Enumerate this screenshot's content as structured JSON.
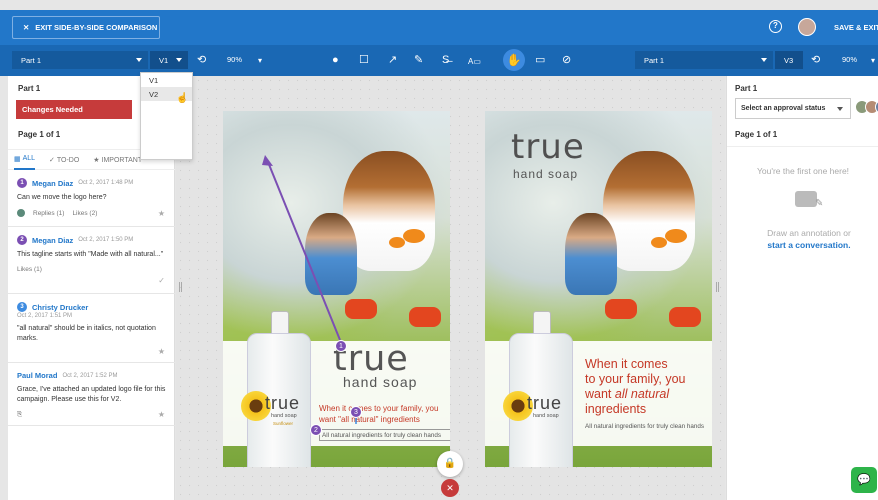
{
  "header": {
    "exit_label": "EXIT SIDE-BY-SIDE COMPARISON",
    "help_icon": "question-circle-icon",
    "save_exit_label": "SAVE & EXIT"
  },
  "toolbar": {
    "left_part": "Part 1",
    "left_version": "V1",
    "left_zoom": "90%",
    "right_part": "Part 1",
    "right_version": "V3",
    "right_zoom": "90%"
  },
  "version_dropdown": {
    "options": [
      "V1",
      "V2"
    ]
  },
  "left_panel": {
    "part_title": "Part 1",
    "status": "Changes Needed",
    "page_label": "Page 1 of 1",
    "tabs": [
      "ALL",
      "TO-DO",
      "IMPORTANT"
    ],
    "comments": [
      {
        "num": "1",
        "author": "Megan Diaz",
        "date": "Oct 2, 2017 1:48 PM",
        "text": "Can we move the logo here?",
        "replies": "Replies (1)",
        "likes": "Likes (2)"
      },
      {
        "num": "2",
        "author": "Megan Diaz",
        "date": "Oct 2, 2017 1:50 PM",
        "text": "This tagline starts with \"Made with all natural...\"",
        "likes": "Likes (1)"
      },
      {
        "num": "3",
        "author": "Christy Drucker",
        "date": "Oct 2, 2017 1:51 PM",
        "text": "\"all natural\" should be in italics, not quotation marks."
      },
      {
        "author": "Paul Morad",
        "date": "Oct 2, 2017 1:52 PM",
        "text": "Grace, I've attached an updated logo file for this campaign. Please use this for V2."
      }
    ]
  },
  "left_image": {
    "brand": "true",
    "brand_sub": "hand soap",
    "bottle_brand": "true",
    "bottle_sub": "hand soap",
    "bottle_flavor": "Sunflower",
    "tagline": "When it comes to your family, you want \"all natural\" ingredients",
    "natural_line": "All natural ingredients for truly clean hands"
  },
  "right_image": {
    "brand": "true",
    "brand_sub": "hand soap",
    "bottle_brand": "true",
    "bottle_sub": "hand soap",
    "tagline_1": "When it comes",
    "tagline_2": "to your family, you",
    "tagline_3a": "want ",
    "tagline_3b": "all natural",
    "tagline_4": "ingredients",
    "natural_line": "All natural ingredients for truly clean hands"
  },
  "right_panel": {
    "part_title": "Part 1",
    "approval_placeholder": "Select an approval status",
    "page_label": "Page 1 of 1",
    "empty_title": "You're the first one here!",
    "empty_line": "Draw an annotation or",
    "empty_link": "start a conversation."
  },
  "colors": {
    "header_blue": "#2277c9",
    "toolbar_blue": "#1a68b4",
    "status_red": "#c63b3b",
    "annotation_purple": "#7b4fb3",
    "chat_green": "#2eb44a"
  }
}
